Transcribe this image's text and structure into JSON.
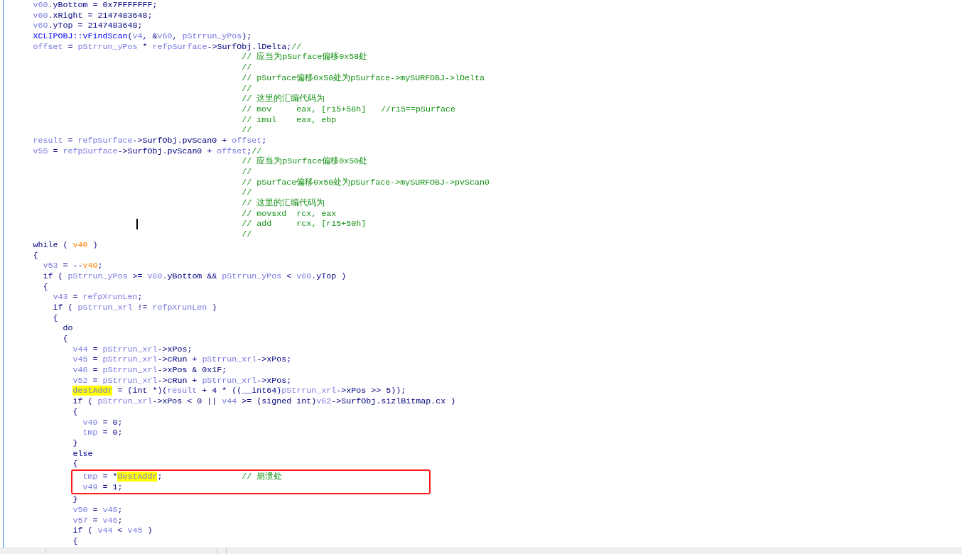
{
  "pseudocode": {
    "lines": [
      {
        "tokens": [
          {
            "text": "v60",
            "kind": "var"
          },
          {
            "text": ".yBottom = 0x7FFFFFFF;",
            "kind": "plain"
          }
        ]
      },
      {
        "tokens": [
          {
            "text": "v60",
            "kind": "var"
          },
          {
            "text": ".xRight = 2147483648;",
            "kind": "plain"
          }
        ]
      },
      {
        "tokens": [
          {
            "text": "v60",
            "kind": "var"
          },
          {
            "text": ".yTop = 2147483648;",
            "kind": "plain"
          }
        ]
      },
      {
        "tokens": [
          {
            "text": "XCLIPOBJ::vFindScan",
            "kind": "func"
          },
          {
            "text": "(",
            "kind": "plain"
          },
          {
            "text": "v4",
            "kind": "var"
          },
          {
            "text": ", &",
            "kind": "plain"
          },
          {
            "text": "v60",
            "kind": "var"
          },
          {
            "text": ", ",
            "kind": "plain"
          },
          {
            "text": "pStrrun_yPos",
            "kind": "var"
          },
          {
            "text": ");",
            "kind": "plain"
          }
        ]
      },
      {
        "tokens": [
          {
            "text": "offset",
            "kind": "var"
          },
          {
            "text": " = ",
            "kind": "plain"
          },
          {
            "text": "pStrrun_yPos",
            "kind": "var"
          },
          {
            "text": " * ",
            "kind": "plain"
          },
          {
            "text": "refpSurface",
            "kind": "var"
          },
          {
            "text": "->SurfObj.lDelta;",
            "kind": "plain"
          },
          {
            "text": "//",
            "kind": "comment"
          }
        ],
        "comment_block": [
          "// 应当为pSurface偏移0x58处",
          "//",
          "// pSurface偏移0x58处为pSurface->mySURFOBJ->lDelta",
          "//",
          "// 这里的汇编代码为",
          "// mov     eax, [r15+58h]   //r15==pSurface",
          "// imul    eax, ebp",
          "//"
        ]
      },
      {
        "tokens": [
          {
            "text": "result",
            "kind": "var"
          },
          {
            "text": " = ",
            "kind": "plain"
          },
          {
            "text": "refpSurface",
            "kind": "var"
          },
          {
            "text": "->SurfObj.pvScan0 + ",
            "kind": "plain"
          },
          {
            "text": "offset",
            "kind": "var"
          },
          {
            "text": ";",
            "kind": "plain"
          }
        ]
      },
      {
        "tokens": [
          {
            "text": "v55",
            "kind": "var"
          },
          {
            "text": " = ",
            "kind": "plain"
          },
          {
            "text": "refpSurface",
            "kind": "var"
          },
          {
            "text": "->SurfObj.pvScan0 + ",
            "kind": "plain"
          },
          {
            "text": "offset",
            "kind": "var"
          },
          {
            "text": ";",
            "kind": "plain"
          },
          {
            "text": "//",
            "kind": "comment"
          }
        ],
        "comment_block": [
          "// 应当为pSurface偏移0x50处",
          "//",
          "// pSurface偏移0x58处为pSurface->mySURFOBJ->pvScan0",
          "//",
          "// 这里的汇编代码为",
          "// movsxd  rcx, eax",
          "// add     rcx, [r15+50h]",
          "//"
        ]
      },
      {
        "tokens": [
          {
            "text": "while ( ",
            "kind": "plain"
          },
          {
            "text": "v40",
            "kind": "arg"
          },
          {
            "text": " )",
            "kind": "plain"
          }
        ]
      },
      {
        "tokens": [
          {
            "text": "{",
            "kind": "plain"
          }
        ],
        "children": [
          {
            "tokens": [
              {
                "text": "v53",
                "kind": "var"
              },
              {
                "text": " = --",
                "kind": "plain"
              },
              {
                "text": "v40",
                "kind": "arg"
              },
              {
                "text": ";",
                "kind": "plain"
              }
            ]
          },
          {
            "tokens": [
              {
                "text": "if ( ",
                "kind": "plain"
              },
              {
                "text": "pStrrun_yPos",
                "kind": "var"
              },
              {
                "text": " >= ",
                "kind": "plain"
              },
              {
                "text": "v60",
                "kind": "var"
              },
              {
                "text": ".yBottom && ",
                "kind": "plain"
              },
              {
                "text": "pStrrun_yPos",
                "kind": "var"
              },
              {
                "text": " < ",
                "kind": "plain"
              },
              {
                "text": "v60",
                "kind": "var"
              },
              {
                "text": ".yTop )",
                "kind": "plain"
              }
            ]
          },
          {
            "tokens": [
              {
                "text": "{",
                "kind": "plain"
              }
            ],
            "children": [
              {
                "tokens": [
                  {
                    "text": "v43",
                    "kind": "var"
                  },
                  {
                    "text": " = ",
                    "kind": "plain"
                  },
                  {
                    "text": "refpXrunLen",
                    "kind": "var"
                  },
                  {
                    "text": ";",
                    "kind": "plain"
                  }
                ]
              },
              {
                "tokens": [
                  {
                    "text": "if ( ",
                    "kind": "plain"
                  },
                  {
                    "text": "pStrrun_xrl",
                    "kind": "var"
                  },
                  {
                    "text": " != ",
                    "kind": "plain"
                  },
                  {
                    "text": "refpXrunLen",
                    "kind": "var"
                  },
                  {
                    "text": " )",
                    "kind": "plain"
                  }
                ]
              },
              {
                "tokens": [
                  {
                    "text": "{",
                    "kind": "plain"
                  }
                ],
                "children": [
                  {
                    "tokens": [
                      {
                        "text": "do",
                        "kind": "plain"
                      }
                    ]
                  },
                  {
                    "tokens": [
                      {
                        "text": "{",
                        "kind": "plain"
                      }
                    ],
                    "children": [
                      {
                        "tokens": [
                          {
                            "text": "v44",
                            "kind": "var"
                          },
                          {
                            "text": " = ",
                            "kind": "plain"
                          },
                          {
                            "text": "pStrrun_xrl",
                            "kind": "var"
                          },
                          {
                            "text": "->xPos;",
                            "kind": "plain"
                          }
                        ]
                      },
                      {
                        "tokens": [
                          {
                            "text": "v45",
                            "kind": "var"
                          },
                          {
                            "text": " = ",
                            "kind": "plain"
                          },
                          {
                            "text": "pStrrun_xrl",
                            "kind": "var"
                          },
                          {
                            "text": "->cRun + ",
                            "kind": "plain"
                          },
                          {
                            "text": "pStrrun_xrl",
                            "kind": "var"
                          },
                          {
                            "text": "->xPos;",
                            "kind": "plain"
                          }
                        ]
                      },
                      {
                        "tokens": [
                          {
                            "text": "v46",
                            "kind": "var"
                          },
                          {
                            "text": " = ",
                            "kind": "plain"
                          },
                          {
                            "text": "pStrrun_xrl",
                            "kind": "var"
                          },
                          {
                            "text": "->xPos & 0x1F;",
                            "kind": "plain"
                          }
                        ]
                      },
                      {
                        "tokens": [
                          {
                            "text": "v52",
                            "kind": "var"
                          },
                          {
                            "text": " = ",
                            "kind": "plain"
                          },
                          {
                            "text": "pStrrun_xrl",
                            "kind": "var"
                          },
                          {
                            "text": "->cRun + ",
                            "kind": "plain"
                          },
                          {
                            "text": "pStrrun_xrl",
                            "kind": "var"
                          },
                          {
                            "text": "->xPos;",
                            "kind": "plain"
                          }
                        ]
                      },
                      {
                        "tokens": [
                          {
                            "text": "destAddr",
                            "kind": "highlight"
                          },
                          {
                            "text": " = (int *)(",
                            "kind": "plain"
                          },
                          {
                            "text": "result",
                            "kind": "var"
                          },
                          {
                            "text": " + 4 * ((__int64)",
                            "kind": "plain"
                          },
                          {
                            "text": "pStrrun_xrl",
                            "kind": "var"
                          },
                          {
                            "text": "->xPos >> 5));",
                            "kind": "plain"
                          }
                        ]
                      },
                      {
                        "tokens": [
                          {
                            "text": "if ( ",
                            "kind": "plain"
                          },
                          {
                            "text": "pStrrun_xrl",
                            "kind": "var"
                          },
                          {
                            "text": "->xPos < 0 || ",
                            "kind": "plain"
                          },
                          {
                            "text": "v44",
                            "kind": "var"
                          },
                          {
                            "text": " >= (signed int)",
                            "kind": "plain"
                          },
                          {
                            "text": "v62",
                            "kind": "var"
                          },
                          {
                            "text": "->SurfObj.sizlBitmap.cx )",
                            "kind": "plain"
                          }
                        ]
                      },
                      {
                        "tokens": [
                          {
                            "text": "{",
                            "kind": "plain"
                          }
                        ],
                        "children": [
                          {
                            "tokens": [
                              {
                                "text": "v49",
                                "kind": "var"
                              },
                              {
                                "text": " = 0;",
                                "kind": "plain"
                              }
                            ]
                          },
                          {
                            "tokens": [
                              {
                                "text": "tmp",
                                "kind": "var"
                              },
                              {
                                "text": " = 0;",
                                "kind": "plain"
                              }
                            ]
                          }
                        ]
                      },
                      {
                        "tokens": [
                          {
                            "text": "}",
                            "kind": "plain"
                          }
                        ]
                      },
                      {
                        "tokens": [
                          {
                            "text": "else",
                            "kind": "plain"
                          }
                        ]
                      },
                      {
                        "tokens": [
                          {
                            "text": "{",
                            "kind": "plain"
                          }
                        ],
                        "children": [
                          {
                            "kind": "annotation",
                            "children": [
                              {
                                "tokens": [
                                  {
                                    "text": "tmp",
                                    "kind": "var"
                                  },
                                  {
                                    "text": " = *",
                                    "kind": "plain"
                                  },
                                  {
                                    "text": "destAddr",
                                    "kind": "highlight"
                                  },
                                  {
                                    "text": ";",
                                    "kind": "plain"
                                  }
                                ],
                                "comment": "// 崩溃处"
                              },
                              {
                                "tokens": [
                                  {
                                    "text": "v49",
                                    "kind": "var"
                                  },
                                  {
                                    "text": " = 1;",
                                    "kind": "plain"
                                  }
                                ]
                              }
                            ]
                          }
                        ]
                      },
                      {
                        "tokens": [
                          {
                            "text": "}",
                            "kind": "plain"
                          }
                        ]
                      },
                      {
                        "tokens": [
                          {
                            "text": "v50",
                            "kind": "var"
                          },
                          {
                            "text": " = ",
                            "kind": "plain"
                          },
                          {
                            "text": "v46",
                            "kind": "var"
                          },
                          {
                            "text": ";",
                            "kind": "plain"
                          }
                        ]
                      },
                      {
                        "tokens": [
                          {
                            "text": "v57",
                            "kind": "var"
                          },
                          {
                            "text": " = ",
                            "kind": "plain"
                          },
                          {
                            "text": "v46",
                            "kind": "var"
                          },
                          {
                            "text": ";",
                            "kind": "plain"
                          }
                        ]
                      },
                      {
                        "tokens": [
                          {
                            "text": "if ( ",
                            "kind": "plain"
                          },
                          {
                            "text": "v44",
                            "kind": "var"
                          },
                          {
                            "text": " < ",
                            "kind": "plain"
                          },
                          {
                            "text": "v45",
                            "kind": "var"
                          },
                          {
                            "text": " )",
                            "kind": "plain"
                          }
                        ]
                      },
                      {
                        "tokens": [
                          {
                            "text": "{",
                            "kind": "plain"
                          }
                        ]
                      }
                    ]
                  }
                ]
              }
            ]
          }
        ]
      }
    ]
  }
}
